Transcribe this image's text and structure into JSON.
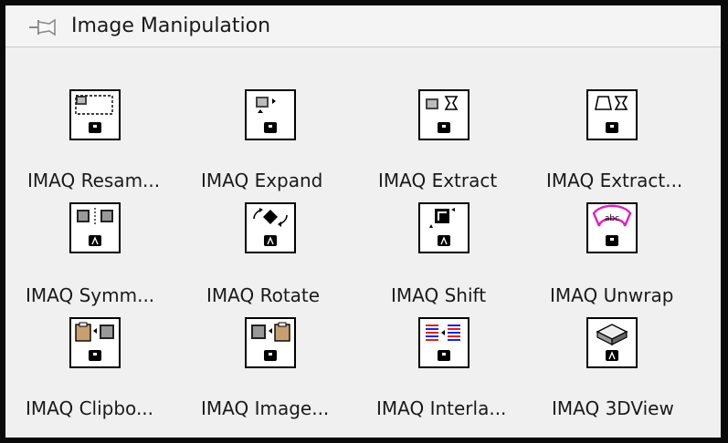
{
  "palette": {
    "title": "Image Manipulation",
    "pin_icon": "pin-icon",
    "items": [
      {
        "label": "IMAQ Resam...",
        "icon": "resample-icon",
        "badge": "polymorphic-instance-icon"
      },
      {
        "label": "IMAQ Expand",
        "icon": "expand-icon",
        "badge": "polymorphic-instance-icon"
      },
      {
        "label": "IMAQ Extract",
        "icon": "extract-icon",
        "badge": "polymorphic-instance-icon"
      },
      {
        "label": "IMAQ Extract...",
        "icon": "extract-tetragon-icon",
        "badge": "polymorphic-instance-icon"
      },
      {
        "label": "IMAQ Symm...",
        "icon": "symmetry-icon",
        "badge": "ai-badge-icon"
      },
      {
        "label": "IMAQ Rotate",
        "icon": "rotate-icon",
        "badge": "ai-badge-icon"
      },
      {
        "label": "IMAQ Shift",
        "icon": "shift-icon",
        "badge": "ai-badge-icon"
      },
      {
        "label": "IMAQ Unwrap",
        "icon": "unwrap-icon",
        "badge": "polymorphic-instance-icon"
      },
      {
        "label": "IMAQ Clipbo...",
        "icon": "clipboard-to-image-icon",
        "badge": "polymorphic-instance-icon"
      },
      {
        "label": "IMAQ Image...",
        "icon": "image-to-clipboard-icon",
        "badge": "polymorphic-instance-icon"
      },
      {
        "label": "IMAQ Interla...",
        "icon": "interlace-icon",
        "badge": "polymorphic-instance-icon"
      },
      {
        "label": "IMAQ 3DView",
        "icon": "3dview-icon",
        "badge": "ai-badge-icon"
      }
    ]
  }
}
